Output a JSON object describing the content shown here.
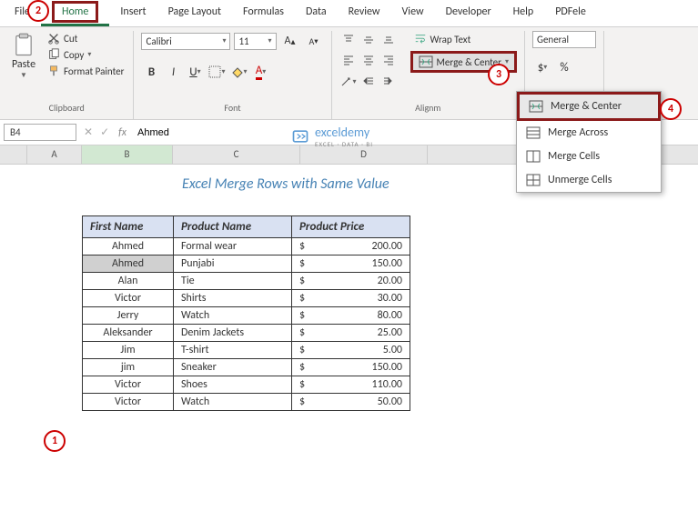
{
  "tabs": [
    "File",
    "Home",
    "Insert",
    "Page Layout",
    "Formulas",
    "Data",
    "Review",
    "View",
    "Developer",
    "Help",
    "PDFele"
  ],
  "clipboard": {
    "paste": "Paste",
    "cut": "Cut",
    "copy": "Copy",
    "fmt": "Format Painter",
    "label": "Clipboard"
  },
  "font": {
    "name": "Calibri",
    "size": "11",
    "label": "Font"
  },
  "align": {
    "wrap": "Wrap Text",
    "merge": "Merge & Center",
    "label": "Alignm"
  },
  "number": {
    "format": "General"
  },
  "dropdown": {
    "mc": "Merge & Center",
    "ma": "Merge Across",
    "mcl": "Merge Cells",
    "um": "Unmerge Cells"
  },
  "namebox": "B4",
  "formula": "Ahmed",
  "fx": "fx",
  "cols": {
    "A": "A",
    "B": "B",
    "C": "C",
    "D": "D"
  },
  "title": "Excel Merge Rows with Same Value",
  "headers": {
    "fn": "First Name",
    "pn": "Product Name",
    "pp": "Product Price"
  },
  "rows": [
    {
      "name": "Ahmed",
      "prod": "Formal wear",
      "cur": "$",
      "price": "200.00"
    },
    {
      "name": "Ahmed",
      "prod": "Punjabi",
      "cur": "$",
      "price": "150.00"
    },
    {
      "name": "Alan",
      "prod": "Tie",
      "cur": "$",
      "price": "20.00"
    },
    {
      "name": "Victor",
      "prod": "Shirts",
      "cur": "$",
      "price": "30.00"
    },
    {
      "name": "Jerry",
      "prod": "Watch",
      "cur": "$",
      "price": "80.00"
    },
    {
      "name": "Aleksander",
      "prod": "Denim Jackets",
      "cur": "$",
      "price": "25.00"
    },
    {
      "name": "Jim",
      "prod": "T-shirt",
      "cur": "$",
      "price": "5.00"
    },
    {
      "name": "jim",
      "prod": "Sneaker",
      "cur": "$",
      "price": "150.00"
    },
    {
      "name": "Victor",
      "prod": "Shoes",
      "cur": "$",
      "price": "110.00"
    },
    {
      "name": "Victor",
      "prod": "Watch",
      "cur": "$",
      "price": "50.00"
    }
  ],
  "callouts": {
    "c1": "1",
    "c2": "2",
    "c3": "3",
    "c4": "4"
  },
  "logo": {
    "name": "exceldemy",
    "sub": "EXCEL · DATA · BI"
  }
}
